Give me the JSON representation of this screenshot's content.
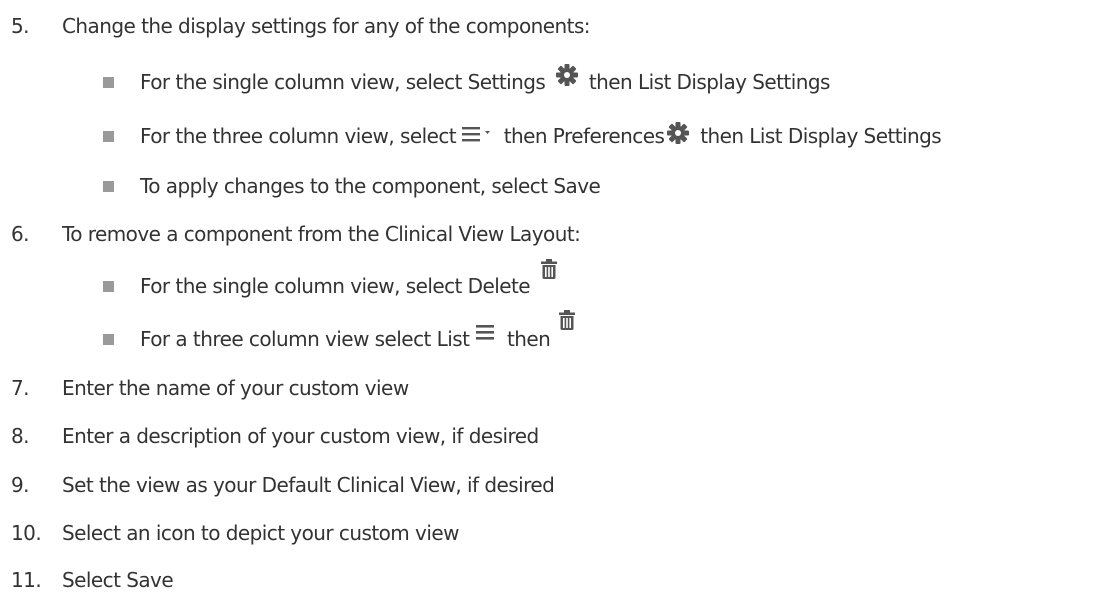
{
  "steps": [
    {
      "number": "5.",
      "text": "Change the display settings for any of the components:",
      "subitems": [
        {
          "parts": [
            "For the single column view, select Settings ",
            " then List Display Settings"
          ],
          "icons": [
            "gear-icon"
          ]
        },
        {
          "parts": [
            "For the three column view, select ",
            " then Preferences",
            " then List Display Settings"
          ],
          "icons": [
            "menu-dropdown-icon",
            "gear-icon"
          ]
        },
        {
          "text": "To apply changes to the component, select Save"
        }
      ]
    },
    {
      "number": "6.",
      "text": "To remove a component from the Clinical View Layout:",
      "subitems": [
        {
          "parts": [
            "For the single column view, select Delete "
          ],
          "icons": [
            "trash-icon"
          ]
        },
        {
          "parts": [
            "For a three column view select List ",
            " then "
          ],
          "icons": [
            "menu-icon",
            "trash-icon"
          ]
        }
      ]
    },
    {
      "number": "7.",
      "text": "Enter the name of your custom view"
    },
    {
      "number": "8.",
      "text": "Enter a description of your custom view, if desired"
    },
    {
      "number": "9.",
      "text": "Set the view as your Default Clinical View, if desired"
    },
    {
      "number": "10.",
      "text": "Select an icon to depict your custom view"
    },
    {
      "number": "11.",
      "text": "Select Save"
    }
  ],
  "colors": {
    "text": "#333333",
    "bullet": "#9a9a9a",
    "icon": "#555555"
  }
}
